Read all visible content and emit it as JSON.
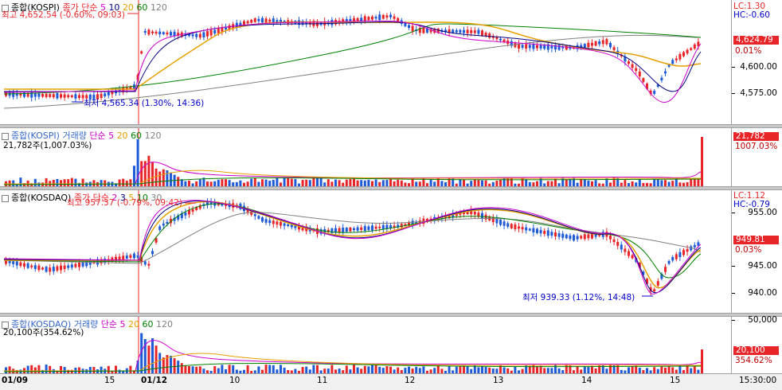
{
  "colors": {
    "up": "#e8262a",
    "down": "#1f5bd6",
    "ma5": "#cc00cc",
    "ma10": "#000080",
    "ma20": "#e6a000",
    "ma60": "#008000",
    "ma120": "#808080",
    "vline": "#e8262a"
  },
  "panes": {
    "kospi_price": {
      "legend": {
        "name": "종합(KOSPI)",
        "type": "종가 단순",
        "p5": "5",
        "p10": "10",
        "p20": "20",
        "p60": "60",
        "p120": "120"
      },
      "lc": "LC:1.30",
      "hc": "HC:-0.60",
      "current": "4,624.79",
      "change": "0.01%",
      "ticks": [
        "4,600.00",
        "4,575.00"
      ],
      "high_note": "최고 4,652.54 (-0.60%, 09:03)",
      "low_note": "최저 4,565.34 (1.30%, 14:36)"
    },
    "kospi_volume": {
      "legend": {
        "name": "종합(KOSPI) 거래량",
        "type": "단순",
        "p5": "5",
        "p20": "20",
        "p60": "60",
        "p120": "120"
      },
      "current_line": "21,782주(1,007.03%)",
      "current": "21,782",
      "change": "1007.03%"
    },
    "kosdaq_price": {
      "legend": {
        "name": "종합(KOSDAQ)",
        "type": "종가 단순",
        "p2": "2",
        "p3": "3",
        "p5": "5",
        "p10": "10",
        "p30": "30"
      },
      "lc": "LC:1.12",
      "hc": "HC:-0.79",
      "current": "949.81",
      "change": "0.03%",
      "ticks": [
        "955.00",
        "945.00",
        "940.00"
      ],
      "high_note": "최고 957.37 (-0.79%, 09:42)",
      "low_note": "최저 939.33 (1.12%, 14:48)"
    },
    "kosdaq_volume": {
      "legend": {
        "name": "종합(KOSDAQ) 거래량",
        "type": "단순",
        "p5": "5",
        "p20": "20",
        "p60": "60",
        "p120": "120"
      },
      "current_line": "20,100주(354.62%)",
      "current": "20,100",
      "change": "354.62%",
      "ticks": [
        "50,000"
      ]
    }
  },
  "xaxis": {
    "labels": [
      "01/09",
      "15",
      "01/12",
      "10",
      "11",
      "12",
      "13",
      "14",
      "15"
    ],
    "time": "15:30:00"
  }
}
